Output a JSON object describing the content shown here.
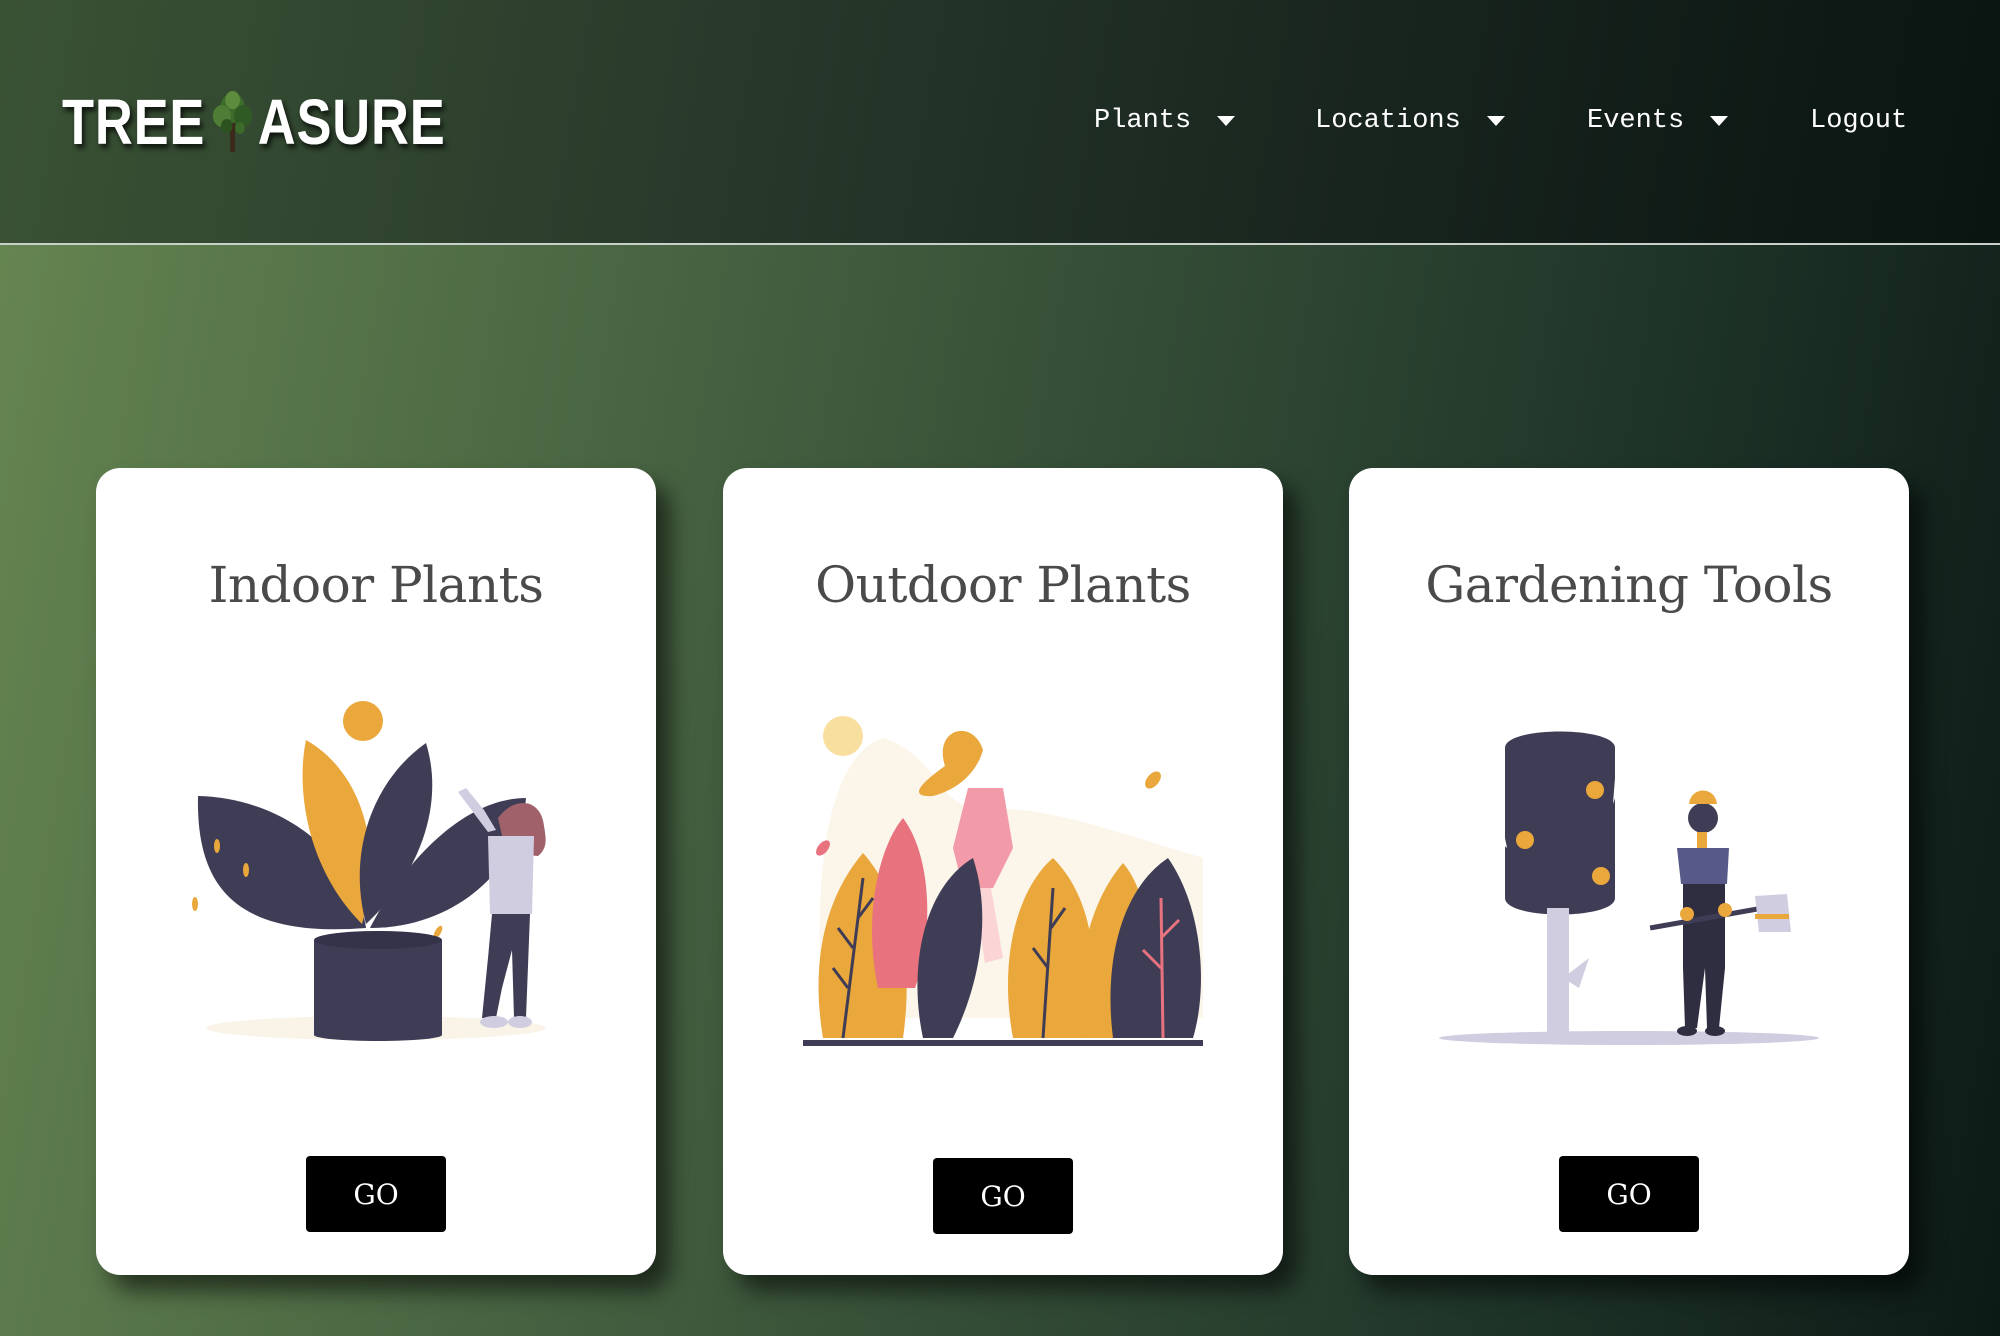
{
  "brand": {
    "left": "TREE",
    "right": "ASURE"
  },
  "nav": {
    "items": [
      {
        "label": "Plants",
        "dropdown": true
      },
      {
        "label": "Locations",
        "dropdown": true
      },
      {
        "label": "Events",
        "dropdown": true
      },
      {
        "label": "Logout",
        "dropdown": false
      }
    ]
  },
  "cards": [
    {
      "title": "Indoor Plants",
      "button": "GO",
      "illustration": "woman-with-potted-plant-illustration"
    },
    {
      "title": "Outdoor Plants",
      "button": "GO",
      "illustration": "woman-walking-in-garden-illustration"
    },
    {
      "title": "Gardening Tools",
      "button": "GO",
      "illustration": "woman-with-axe-and-tree-illustration"
    }
  ],
  "colors": {
    "accent_orange": "#eaa73c",
    "dark_navy": "#3f3d56",
    "pink": "#e8737f",
    "button": "#000000",
    "card": "#ffffff"
  }
}
